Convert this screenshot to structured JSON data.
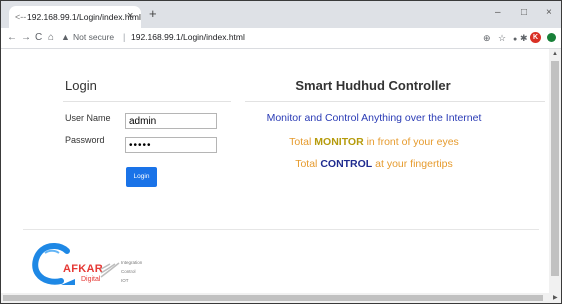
{
  "browser": {
    "tab": {
      "favicon": "<--",
      "title": "192.168.99.1/Login/index.html",
      "close": "×"
    },
    "new_tab": "+",
    "window": {
      "minimize": "–",
      "maximize": "□",
      "close": "×"
    },
    "nav": {
      "back": "←",
      "forward": "→",
      "reload": "C",
      "home": "⌂"
    },
    "omnibox": {
      "warning_icon": "▲",
      "security_label": "Not secure",
      "separator": "|",
      "url": "192.168.99.1/Login/index.html"
    },
    "toolbar_icons": {
      "zoom": "⊕",
      "bookmark": "☆",
      "extension": "●",
      "puzzle": "✱",
      "profile": "K"
    },
    "colors": {
      "profile": "#d93025",
      "ext_green": "#188038"
    }
  },
  "login": {
    "title": "Login",
    "username_label": "User Name",
    "username_value": "admin",
    "password_label": "Password",
    "password_value": "•••••",
    "button_label": "Login"
  },
  "controller": {
    "title": "Smart Hudhud Controller",
    "line1": "Monitor and Control Anything over the Internet",
    "line2": {
      "pre": "Total ",
      "highlight": "MONITOR",
      "post": " in front of your eyes"
    },
    "line3": {
      "pre": "Total ",
      "highlight": "CONTROL",
      "post": " at your fingertips"
    }
  },
  "logo": {
    "brand": "AFKAR",
    "sub": "Digital",
    "tag1": "Integration",
    "tag2": "Control",
    "tag3": "IOT"
  },
  "colors": {
    "accent_blue": "#2a3bb5",
    "accent_orange": "#e69b2e",
    "button": "#1a73e8",
    "logo_red": "#e53935"
  }
}
